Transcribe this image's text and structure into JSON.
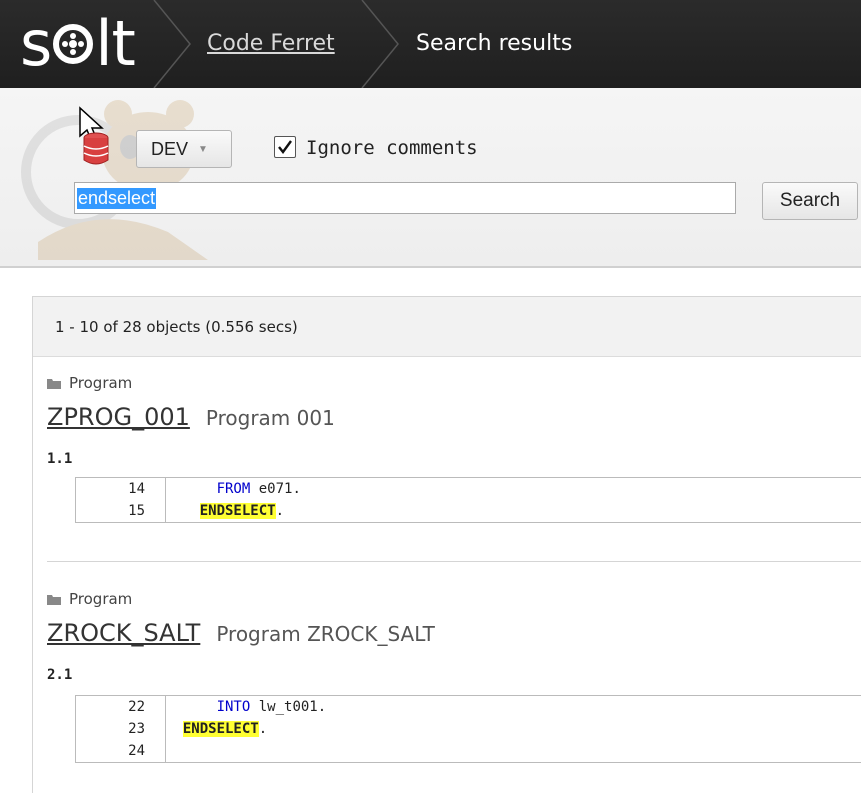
{
  "app": {
    "logo_text": "salt"
  },
  "breadcrumb": {
    "items": [
      {
        "label": "Code Ferret",
        "link": true
      },
      {
        "label": "Search results",
        "link": false
      }
    ]
  },
  "search": {
    "system_select": "DEV",
    "ignore_comments_label": "Ignore comments",
    "ignore_comments_checked": true,
    "query": "endselect",
    "button_label": "Search"
  },
  "results": {
    "summary": "1 - 10 of 28 objects (0.556 secs)",
    "items": [
      {
        "type": "Program",
        "name": "ZPROG_001",
        "description": "Program 001",
        "hit": "1.1",
        "lines": [
          {
            "num": "14",
            "code": "      FROM e071."
          },
          {
            "num": "15",
            "code": "    ENDSELECT."
          }
        ]
      },
      {
        "type": "Program",
        "name": "ZROCK_SALT",
        "description": "Program ZROCK_SALT",
        "hit": "2.1",
        "lines": [
          {
            "num": "22",
            "code": "    INTO lw_t001."
          },
          {
            "num": "23",
            "code": "  ENDSELECT."
          },
          {
            "num": "24",
            "code": ""
          }
        ]
      }
    ]
  },
  "colors": {
    "topbar": "#222222",
    "highlight": "#ffff33",
    "keyword": "#0000cc",
    "selection": "#3399ff"
  }
}
